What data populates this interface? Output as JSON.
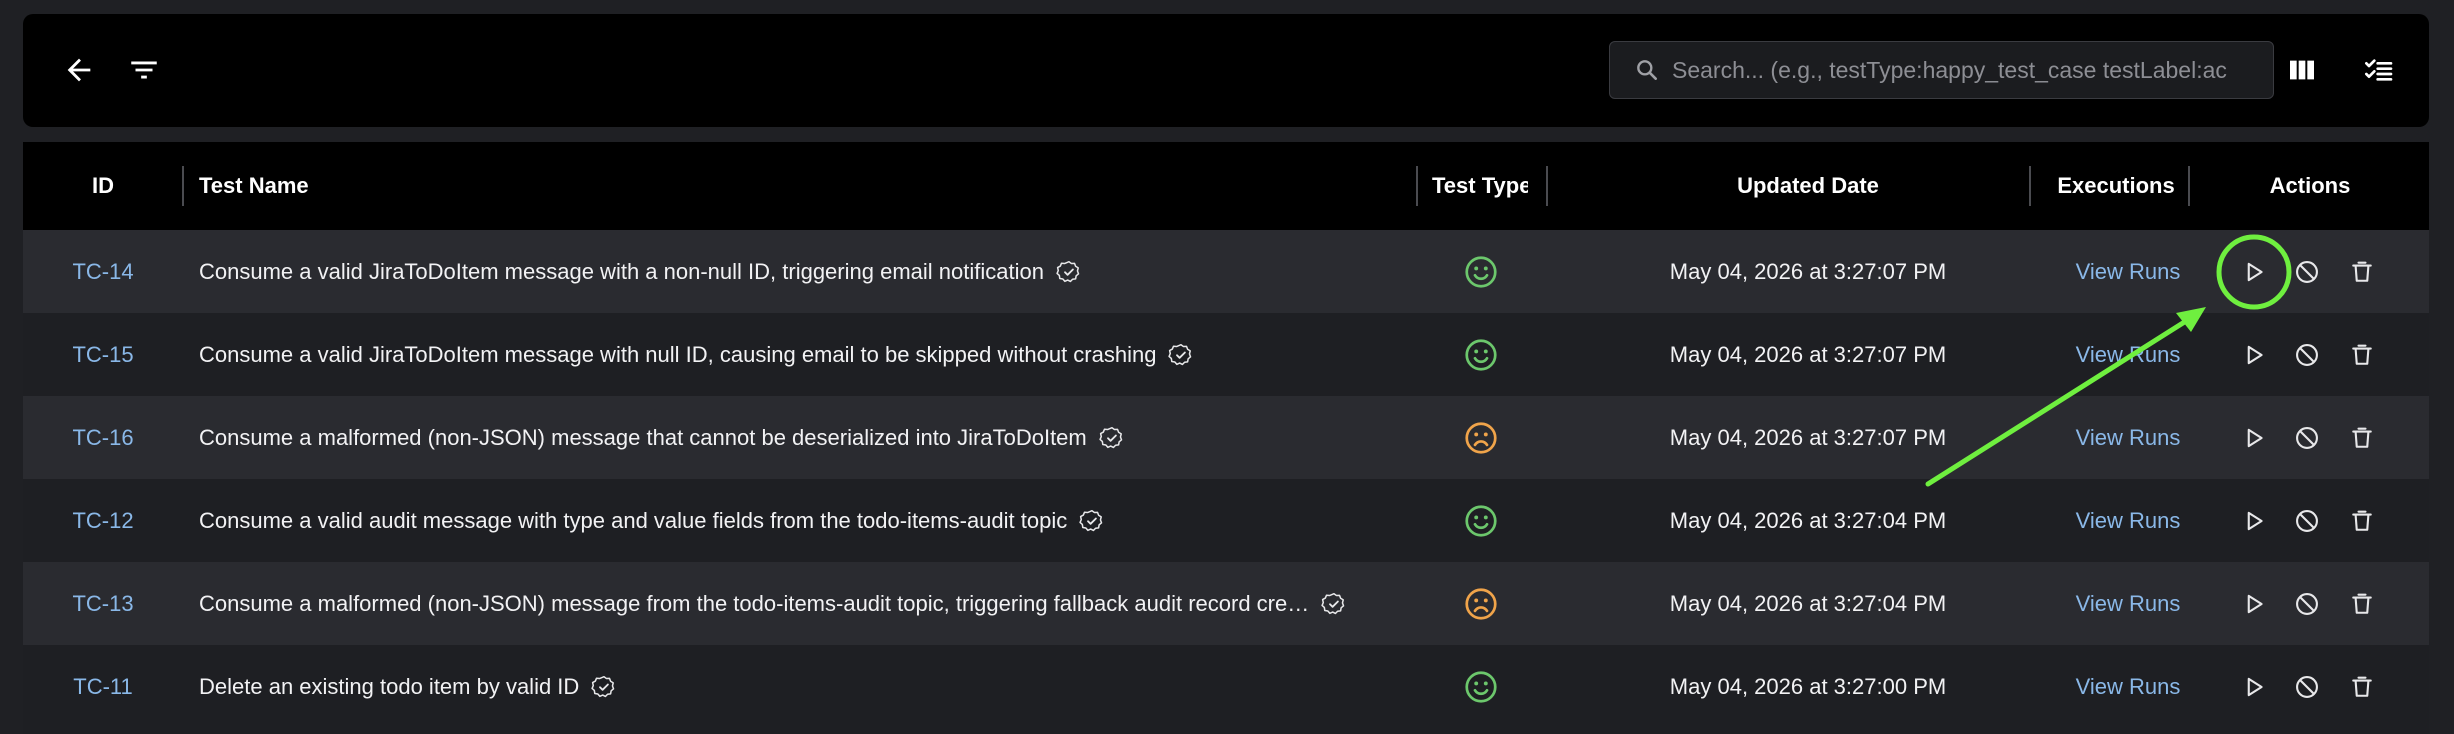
{
  "toolbar": {
    "search_placeholder": "Search... (e.g., testType:happy_test_case testLabel:ac"
  },
  "columns": {
    "id": "ID",
    "name": "Test Name",
    "type": "Test Type",
    "date": "Updated Date",
    "executions": "Executions",
    "actions": "Actions"
  },
  "rows": [
    {
      "id": "TC-14",
      "name": "Consume a valid JiraToDoItem message with a non-null ID, triggering email notification",
      "type": "happy",
      "date": "May 04, 2026 at 3:27:07 PM",
      "runs": "View Runs"
    },
    {
      "id": "TC-15",
      "name": "Consume a valid JiraToDoItem message with null ID, causing email to be skipped without crashing",
      "type": "happy",
      "date": "May 04, 2026 at 3:27:07 PM",
      "runs": "View Runs"
    },
    {
      "id": "TC-16",
      "name": "Consume a malformed (non-JSON) message that cannot be deserialized into JiraToDoItem",
      "type": "sad",
      "date": "May 04, 2026 at 3:27:07 PM",
      "runs": "View Runs"
    },
    {
      "id": "TC-12",
      "name": "Consume a valid audit message with type and value fields from the todo-items-audit topic",
      "type": "happy",
      "date": "May 04, 2026 at 3:27:04 PM",
      "runs": "View Runs"
    },
    {
      "id": "TC-13",
      "name": "Consume a malformed (non-JSON) message from the todo-items-audit topic, triggering fallback audit record cre…",
      "type": "sad",
      "date": "May 04, 2026 at 3:27:04 PM",
      "runs": "View Runs"
    },
    {
      "id": "TC-11",
      "name": "Delete an existing todo item by valid ID",
      "type": "happy",
      "date": "May 04, 2026 at 3:27:00 PM",
      "runs": "View Runs"
    }
  ],
  "colors": {
    "happy": "#6cc76c",
    "sad": "#f0a44a",
    "link": "#8ab8e8",
    "annotation": "#6fef3f"
  },
  "icons": {
    "back": "arrow-left-icon",
    "filter": "filter-icon",
    "search": "search-icon",
    "columns": "columns-icon",
    "checklist": "checklist-icon",
    "happy": "smile-face-icon",
    "sad": "frown-face-icon",
    "verified": "check-circle-icon",
    "run": "play-icon",
    "disable": "block-icon",
    "delete": "trash-icon"
  }
}
